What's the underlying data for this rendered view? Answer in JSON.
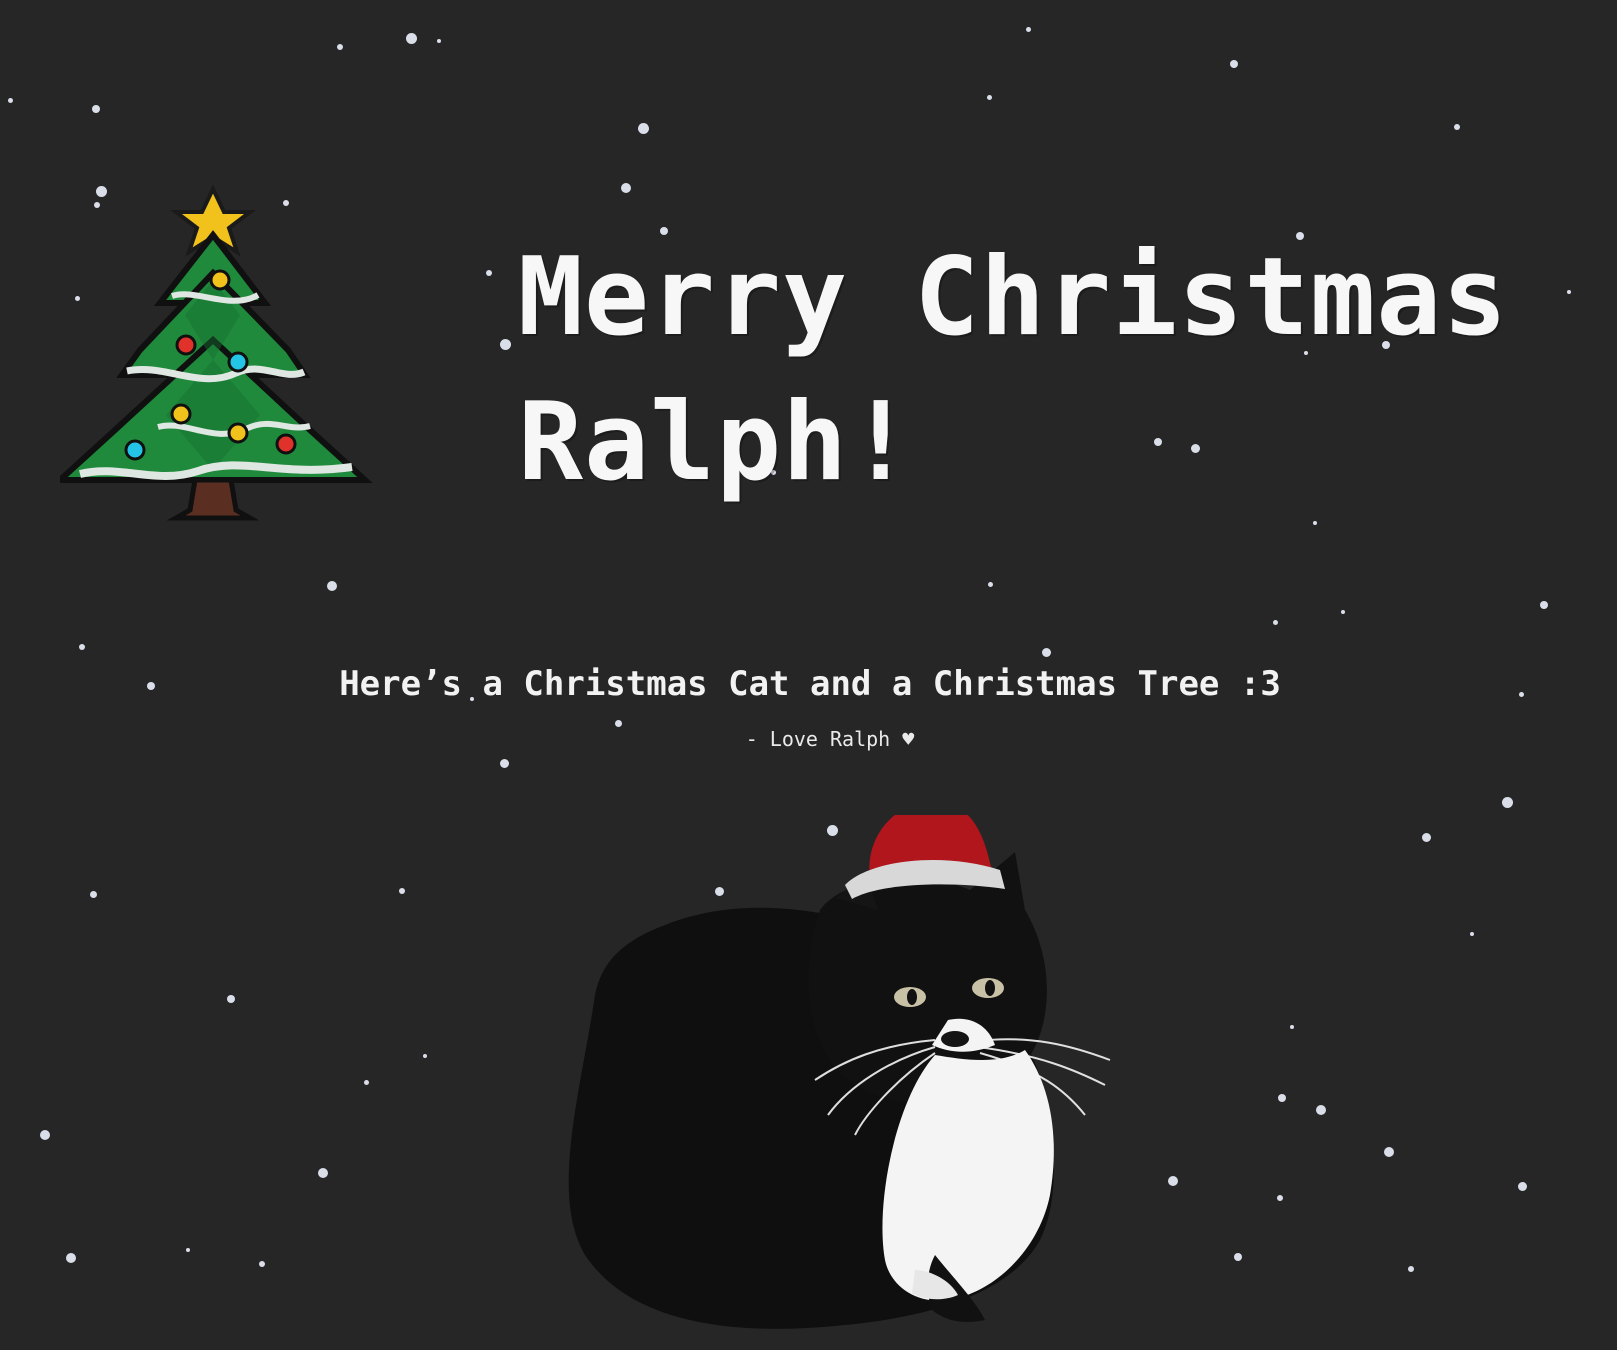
{
  "page": {
    "background_color": "#262627",
    "snow_color": "#eef3ff"
  },
  "greeting": {
    "headline": "Merry Christmas Ralph!",
    "message": "Here’s a Christmas Cat and a Christmas Tree :3",
    "signature": "- Love Ralph ♥"
  },
  "images": {
    "tree": "pixel-christmas-tree",
    "cat": "tuxedo-cat-with-santa-hat"
  },
  "colors": {
    "tree_green": "#1f8a3b",
    "tree_dark_green": "#0f5a25",
    "tree_tinsel": "#dfe7e2",
    "star": "#f1c21b",
    "trunk": "#5a2f22",
    "hat_red": "#b0161b",
    "hat_trim": "#d8d8d8",
    "cat_black": "#0d0d0d",
    "cat_white": "#f4f4f4"
  }
}
